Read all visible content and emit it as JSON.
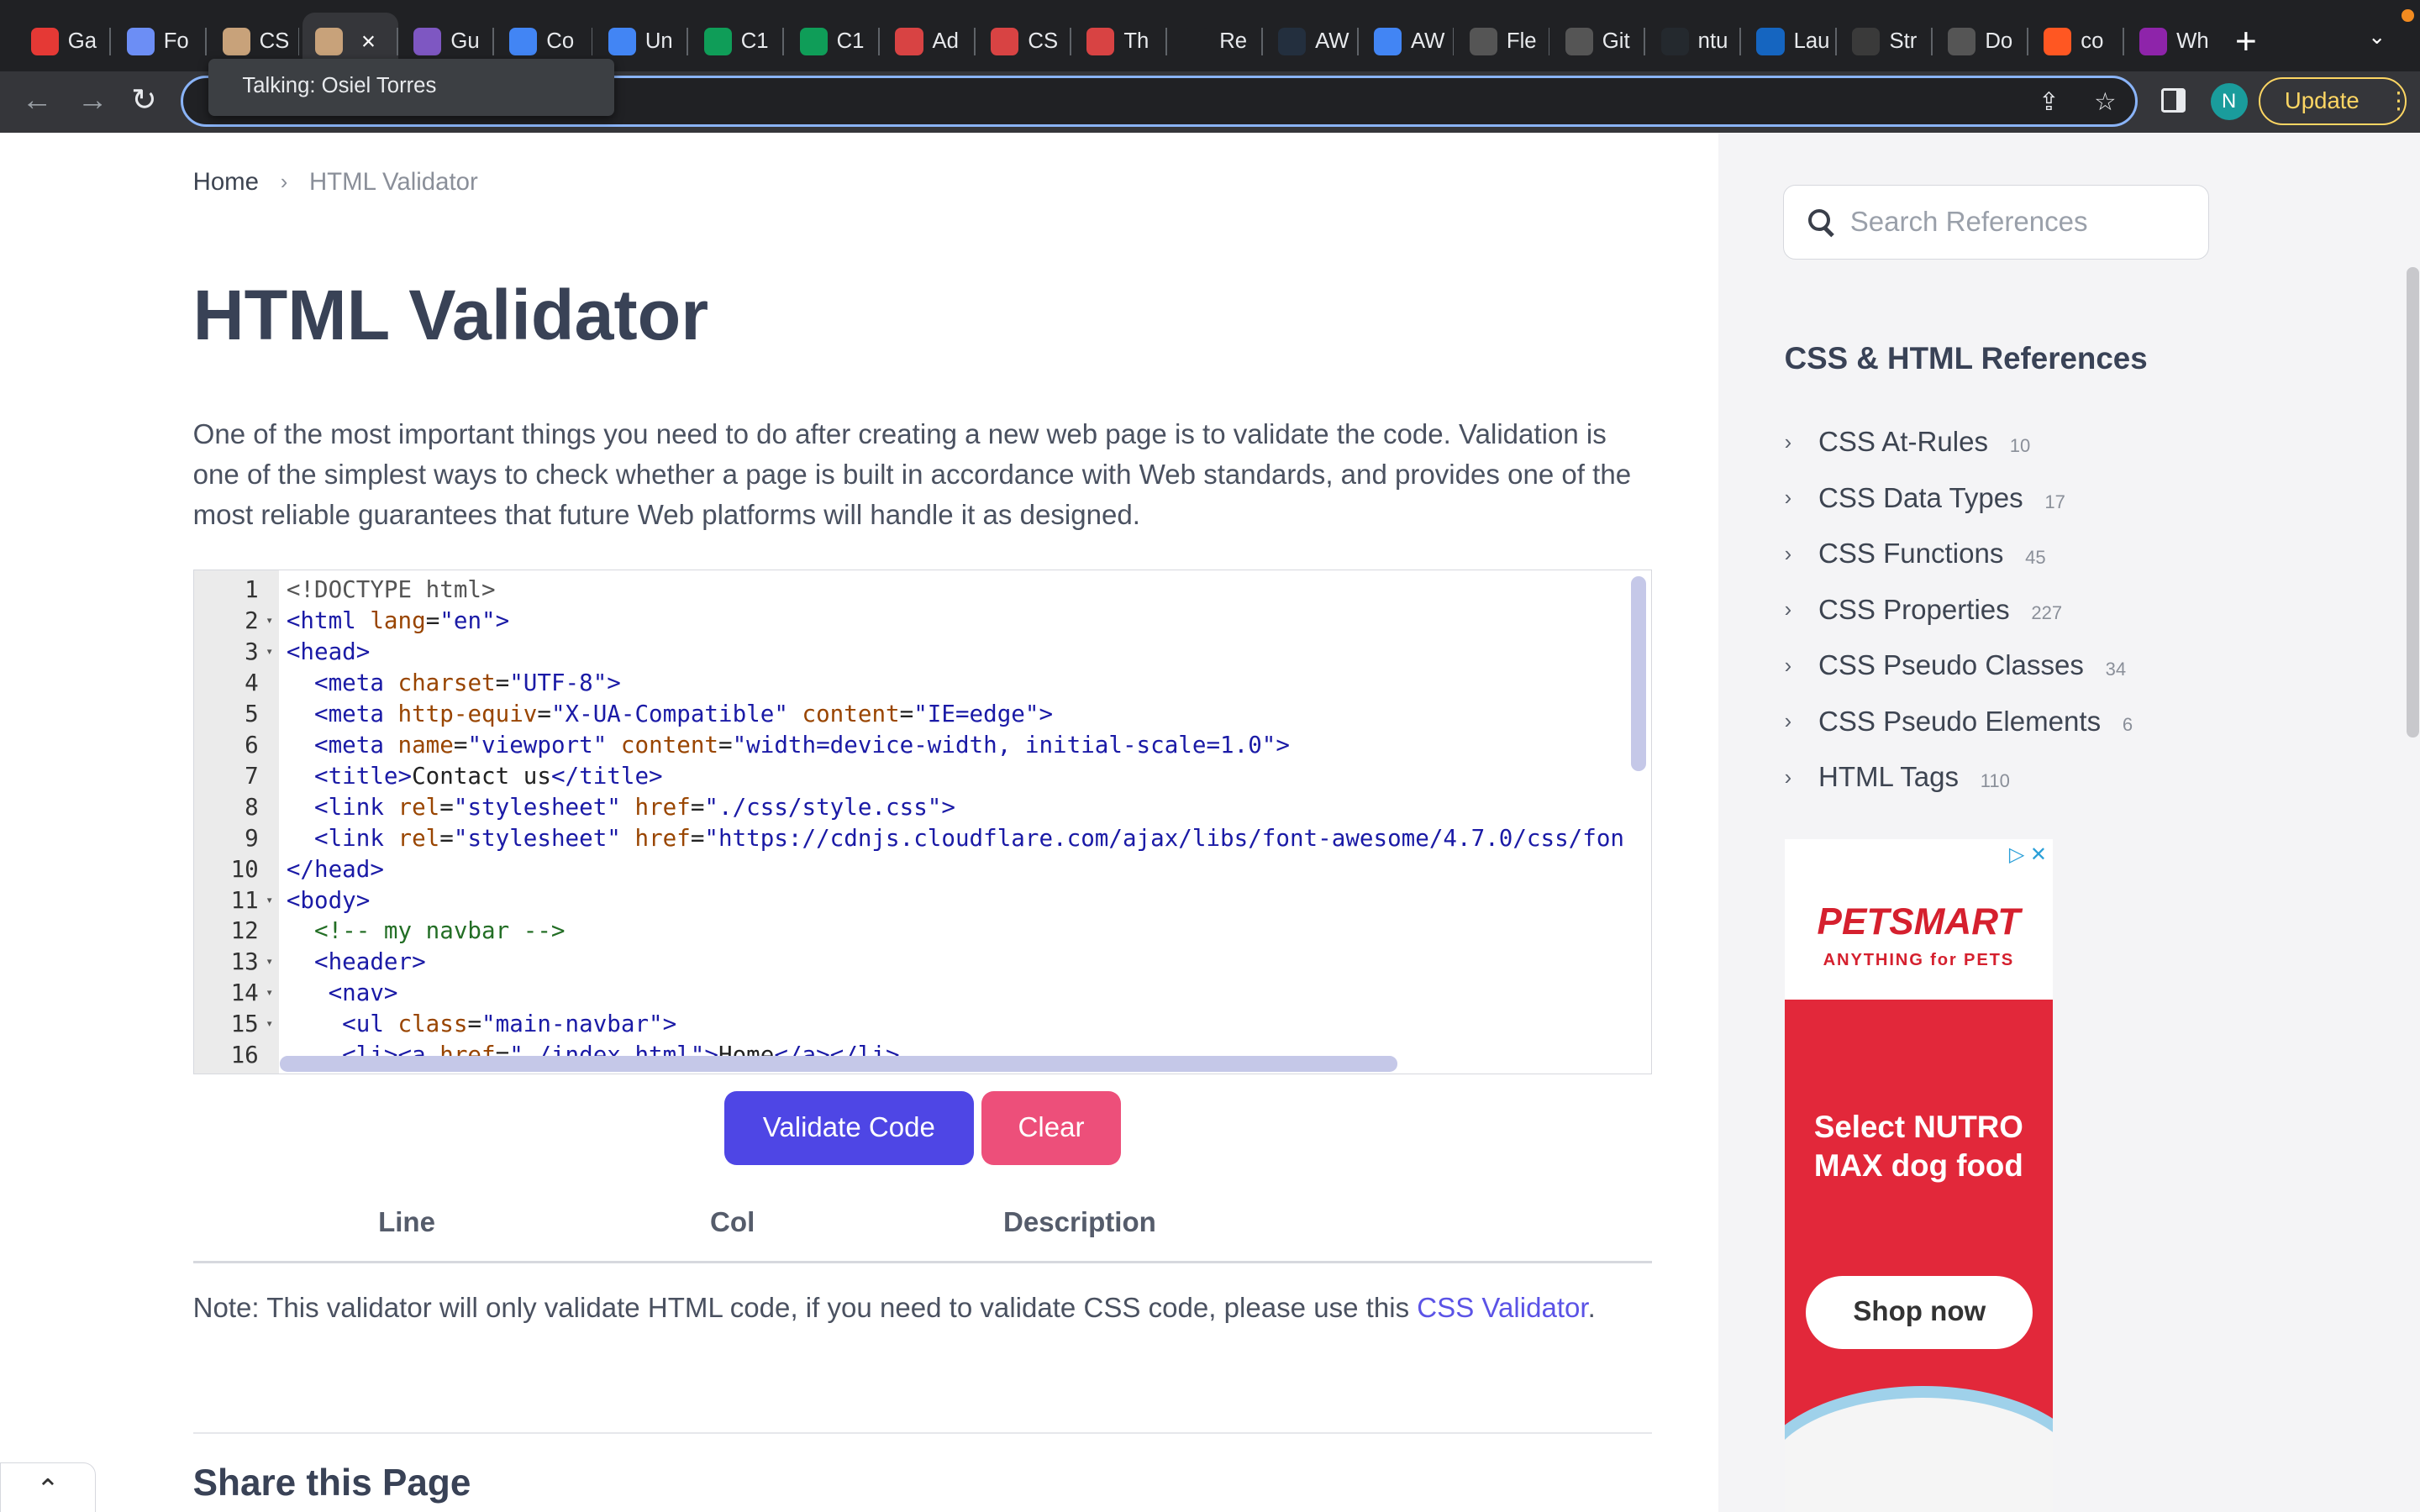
{
  "browser": {
    "tabs": [
      {
        "label": "Ga",
        "color": "#e53935"
      },
      {
        "label": "Fo",
        "color": "#6c8ef5"
      },
      {
        "label": "CS",
        "color": "#c8a27a"
      },
      {
        "label": "",
        "color": "#c8a27a",
        "active": true
      },
      {
        "label": "Gu",
        "color": "#7e57c2"
      },
      {
        "label": "Co",
        "color": "#4285f4"
      },
      {
        "label": "Un",
        "color": "#4285f4"
      },
      {
        "label": "C1",
        "color": "#0f9d58"
      },
      {
        "label": "C1",
        "color": "#0f9d58"
      },
      {
        "label": "Ad",
        "color": "#d84343"
      },
      {
        "label": "CS",
        "color": "#d84343"
      },
      {
        "label": "Th",
        "color": "#d84343"
      },
      {
        "label": "Re",
        "color": "#202124"
      },
      {
        "label": "AW",
        "color": "#232f3e"
      },
      {
        "label": "AW",
        "color": "#4285f4"
      },
      {
        "label": "Fle",
        "color": "#555555"
      },
      {
        "label": "Git",
        "color": "#555555"
      },
      {
        "label": "ntu",
        "color": "#24292e"
      },
      {
        "label": "Lau",
        "color": "#1565c0"
      },
      {
        "label": "Str",
        "color": "#3a3a3a"
      },
      {
        "label": "Do",
        "color": "#555555"
      },
      {
        "label": "co",
        "color": "#ff5722"
      },
      {
        "label": "Wh",
        "color": "#8e24aa"
      }
    ],
    "active_tab_close": "×",
    "new_tab": "+",
    "tab_menu": "⌄",
    "tooltip": "Talking: Osiel Torres",
    "avatar": "N",
    "update_label": "Update",
    "update_menu": "⋮"
  },
  "breadcrumb": {
    "home": "Home",
    "separator": "›",
    "current": "HTML Validator"
  },
  "page_title": "HTML Validator",
  "intro": "One of the most important things you need to do after creating a new web page is to validate the code. Validation is one of the simplest ways to check whether a page is built in accordance with Web standards, and provides one of the most reliable guarantees that future Web platforms will handle it as designed.",
  "editor": {
    "lines": [
      {
        "n": "1",
        "fold": "",
        "html": "<span class=\"d\">&lt;!DOCTYPE html&gt;</span>"
      },
      {
        "n": "2",
        "fold": "▾",
        "html": "<span class=\"t\">&lt;html</span> <span class=\"a\">lang</span>=<span class=\"s\">\"en\"</span><span class=\"t\">&gt;</span>"
      },
      {
        "n": "3",
        "fold": "▾",
        "html": "<span class=\"t\">&lt;head&gt;</span>"
      },
      {
        "n": "4",
        "fold": "",
        "html": "  <span class=\"t\">&lt;meta</span> <span class=\"a\">charset</span>=<span class=\"s\">\"UTF-8\"</span><span class=\"t\">&gt;</span>"
      },
      {
        "n": "5",
        "fold": "",
        "html": "  <span class=\"t\">&lt;meta</span> <span class=\"a\">http-equiv</span>=<span class=\"s\">\"X-UA-Compatible\"</span> <span class=\"a\">content</span>=<span class=\"s\">\"IE=edge\"</span><span class=\"t\">&gt;</span>"
      },
      {
        "n": "6",
        "fold": "",
        "html": "  <span class=\"t\">&lt;meta</span> <span class=\"a\">name</span>=<span class=\"s\">\"viewport\"</span> <span class=\"a\">content</span>=<span class=\"s\">\"width=device-width, initial-scale=1.0\"</span><span class=\"t\">&gt;</span>"
      },
      {
        "n": "7",
        "fold": "",
        "html": "  <span class=\"t\">&lt;title&gt;</span>Contact us<span class=\"t\">&lt;/title&gt;</span>"
      },
      {
        "n": "8",
        "fold": "",
        "html": "  <span class=\"t\">&lt;link</span> <span class=\"a\">rel</span>=<span class=\"s\">\"stylesheet\"</span> <span class=\"a\">href</span>=<span class=\"s\">\"./css/style.css\"</span><span class=\"t\">&gt;</span>"
      },
      {
        "n": "9",
        "fold": "",
        "html": "  <span class=\"t\">&lt;link</span> <span class=\"a\">rel</span>=<span class=\"s\">\"stylesheet\"</span> <span class=\"a\">href</span>=<span class=\"s\">\"https://cdnjs.cloudflare.com/ajax/libs/font-awesome/4.7.0/css/fon</span>"
      },
      {
        "n": "10",
        "fold": "",
        "html": "<span class=\"t\">&lt;/head&gt;</span>"
      },
      {
        "n": "11",
        "fold": "▾",
        "html": "<span class=\"t\">&lt;body&gt;</span>"
      },
      {
        "n": "12",
        "fold": "",
        "html": "  <span class=\"c\">&lt;!-- my navbar --&gt;</span>"
      },
      {
        "n": "13",
        "fold": "▾",
        "html": "  <span class=\"t\">&lt;header&gt;</span>"
      },
      {
        "n": "14",
        "fold": "▾",
        "html": "   <span class=\"t\">&lt;nav&gt;</span>"
      },
      {
        "n": "15",
        "fold": "▾",
        "html": "    <span class=\"t\">&lt;ul</span> <span class=\"a\">class</span>=<span class=\"s\">\"main-navbar\"</span><span class=\"t\">&gt;</span>"
      },
      {
        "n": "16",
        "fold": "",
        "html": "    <span class=\"t\">&lt;li&gt;&lt;a</span> <span class=\"a\">href</span>=<span class=\"s\">\"./index.html\"</span><span class=\"t\">&gt;</span>Home<span class=\"t\">&lt;/a&gt;&lt;/li&gt;</span>"
      }
    ]
  },
  "buttons": {
    "validate": "Validate Code",
    "clear": "Clear"
  },
  "results_table": {
    "columns": [
      "Line",
      "Col",
      "Description"
    ]
  },
  "note": {
    "text": "Note: This validator will only validate HTML code, if you need to validate CSS code, please use this ",
    "link": "CSS Validator",
    "end": "."
  },
  "share_title": "Share this Page",
  "collapse_icon": "⌃",
  "sidebar": {
    "search_placeholder": "Search References",
    "refs_title": "CSS & HTML References",
    "items": [
      {
        "label": "CSS At-Rules",
        "count": "10"
      },
      {
        "label": "CSS Data Types",
        "count": "17"
      },
      {
        "label": "CSS Functions",
        "count": "45"
      },
      {
        "label": "CSS Properties",
        "count": "227"
      },
      {
        "label": "CSS Pseudo Classes",
        "count": "34"
      },
      {
        "label": "CSS Pseudo Elements",
        "count": "6"
      },
      {
        "label": "HTML Tags",
        "count": "110"
      }
    ]
  },
  "ad": {
    "controls": "▷ ✕",
    "brand": "PETSMART",
    "tagline": "ANYTHING for PETS",
    "headline": "Select NUTRO MAX dog food",
    "cta": "Shop now"
  }
}
